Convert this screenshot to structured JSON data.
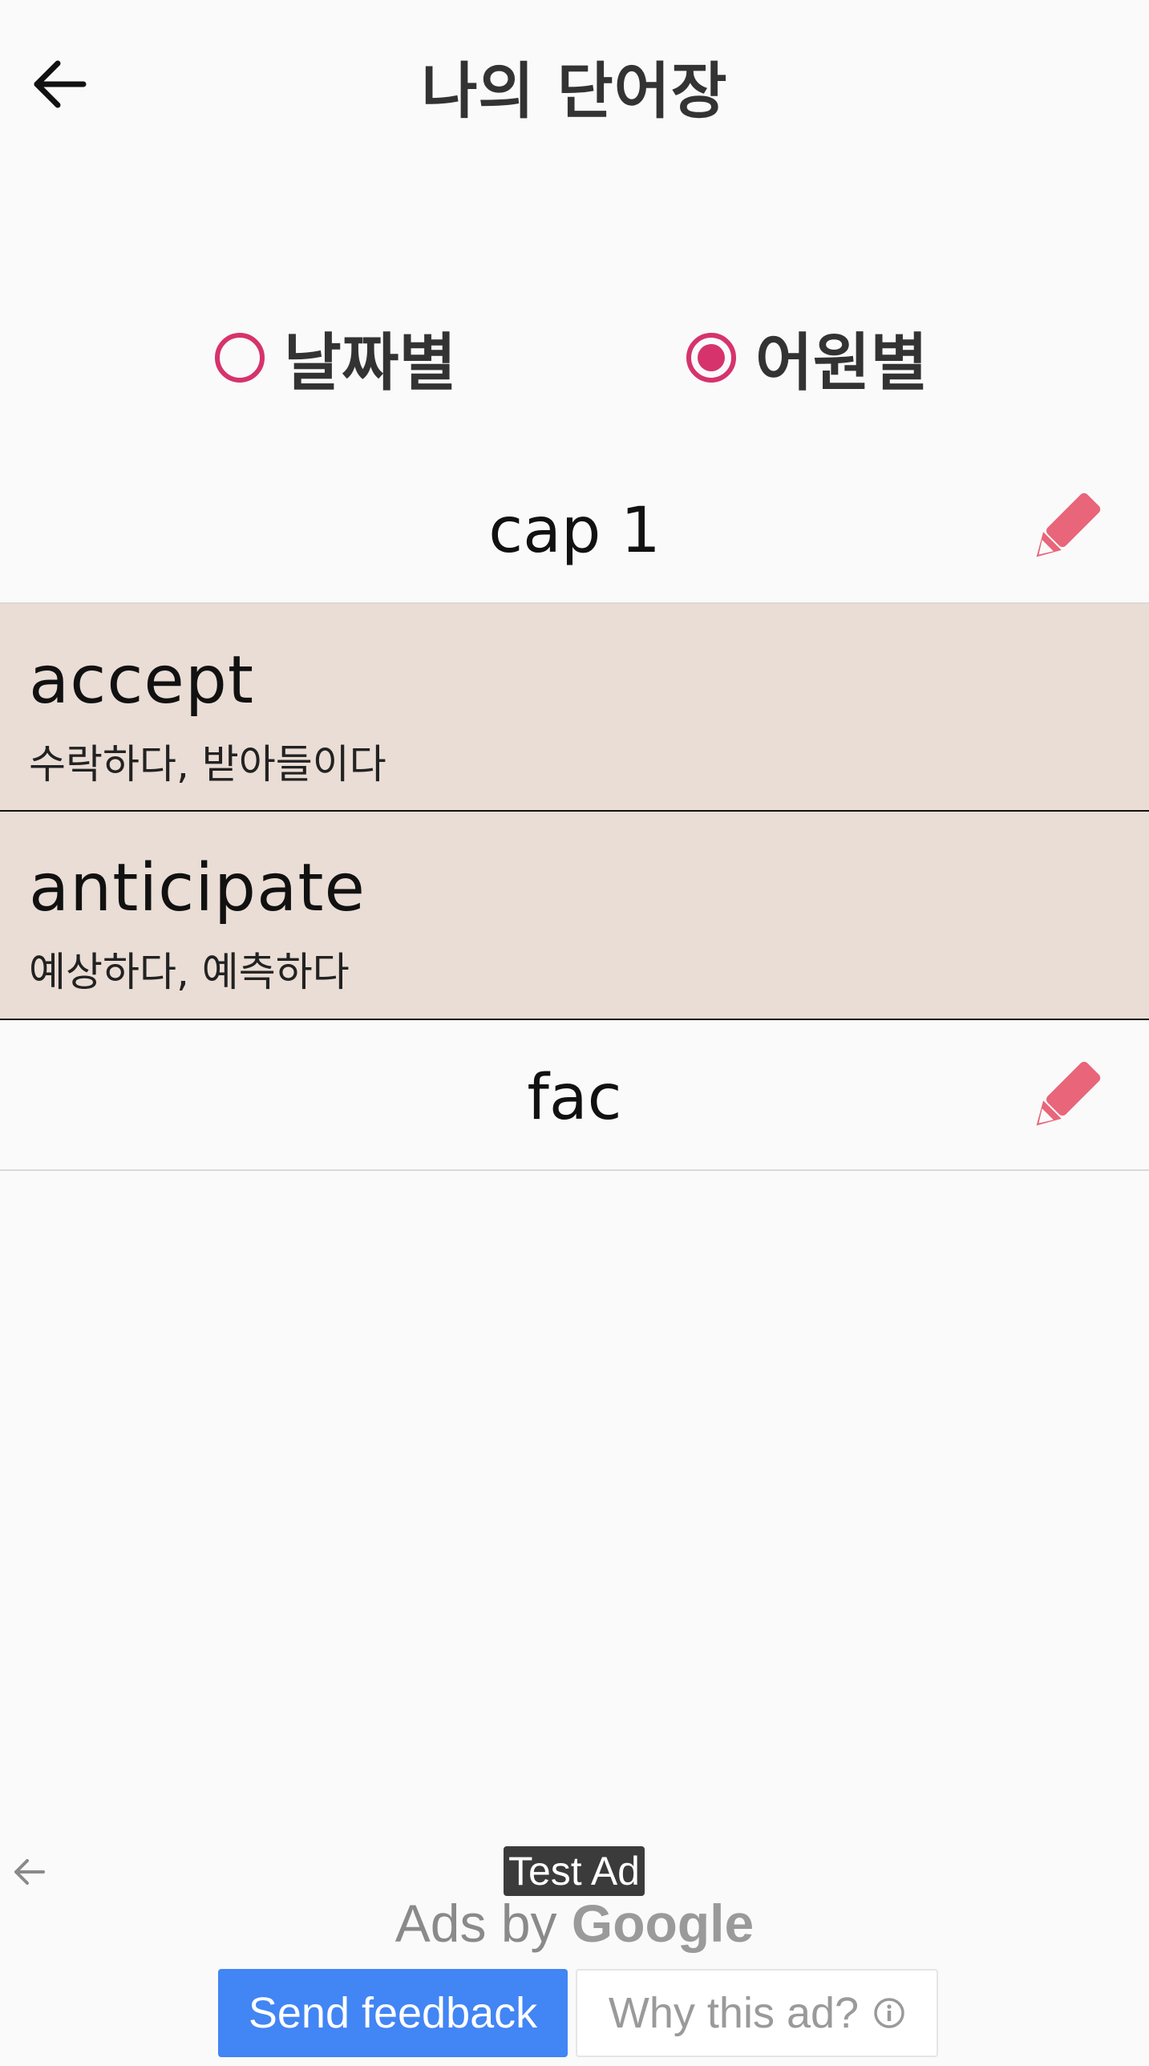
{
  "header": {
    "title": "나의 단어장",
    "back_icon": "arrow-left-icon"
  },
  "sort_options": {
    "date_label": "날짜별",
    "etymology_label": "어원별",
    "selected": "etymology",
    "accent_color": "#d6336c"
  },
  "groups": [
    {
      "title": "cap 1",
      "words": [
        {
          "word": "accept",
          "meaning": "수락하다, 받아들이다"
        },
        {
          "word": "anticipate",
          "meaning": "예상하다, 예측하다"
        }
      ]
    },
    {
      "title": "fac",
      "words": []
    }
  ],
  "edit_icon": "pencil-icon",
  "edit_icon_color": "#e8657a",
  "row_background": "#eaddd5",
  "ad": {
    "badge": "Test Ad",
    "ads_by": "Ads by",
    "brand": "Google",
    "send_feedback": "Send feedback",
    "why_this_ad": "Why this ad?",
    "button_color": "#4285f4"
  }
}
